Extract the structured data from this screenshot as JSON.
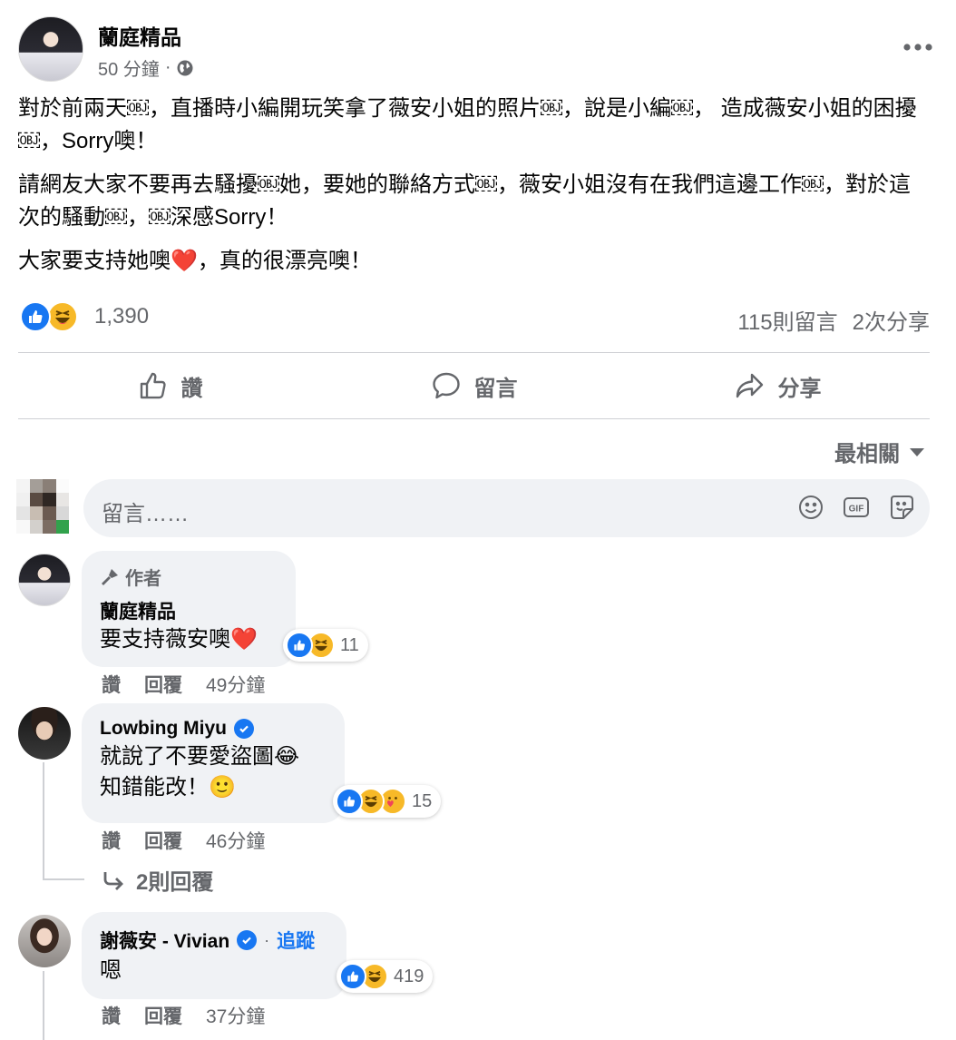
{
  "post": {
    "author": "蘭庭精品",
    "time": "50 分鐘",
    "meta_sep": "·",
    "paragraphs": [
      "對於前兩天￼，直播時小編開玩笑拿了薇安小姐的照片￼，說是小編￼， 造成薇安小姐的困擾￼，Sorry噢！",
      "請網友大家不要再去騷擾￼她，要她的聯絡方式￼，薇安小姐沒有在我們這邊工作￼，對於這次的騷動￼，￼深感Sorry！",
      "大家要支持她噢❤️，真的很漂亮噢！"
    ],
    "reaction_count": "1,390",
    "comments_count": "115則留言",
    "shares_count": "2次分享"
  },
  "actions": {
    "like": "讚",
    "comment": "留言",
    "share": "分享"
  },
  "sort_label": "最相關",
  "composer": {
    "placeholder": "留言……"
  },
  "comments": [
    {
      "badge": "作者",
      "name": "蘭庭精品",
      "text": "要支持薇安噢❤️",
      "react_count": "11",
      "like": "讚",
      "reply": "回覆",
      "time": "49分鐘"
    },
    {
      "name": "Lowbing Miyu",
      "text_line1": "就說了不要愛盜圖😂",
      "text_line2": "知錯能改！🙂",
      "react_count": "15",
      "like": "讚",
      "reply": "回覆",
      "time": "46分鐘",
      "replies_label": "2則回覆"
    },
    {
      "name": "謝薇安 - Vivian",
      "follow_sep": "·",
      "follow": "追蹤",
      "text": "嗯",
      "react_count": "419",
      "like": "讚",
      "reply": "回覆",
      "time": "37分鐘"
    }
  ],
  "colors": {
    "like_blue": "#1877f2",
    "haha_yellow": "#f7b928",
    "secondary_text": "#65676b",
    "bubble_bg": "#f0f2f5"
  },
  "icons": [
    "globe-icon",
    "more-icon",
    "like-icon",
    "comment-icon",
    "share-icon",
    "caret-down-icon",
    "emoji-icon",
    "gif-icon",
    "sticker-icon",
    "mic-icon",
    "verified-icon",
    "reply-arrow-icon",
    "haha-icon",
    "care-icon"
  ]
}
